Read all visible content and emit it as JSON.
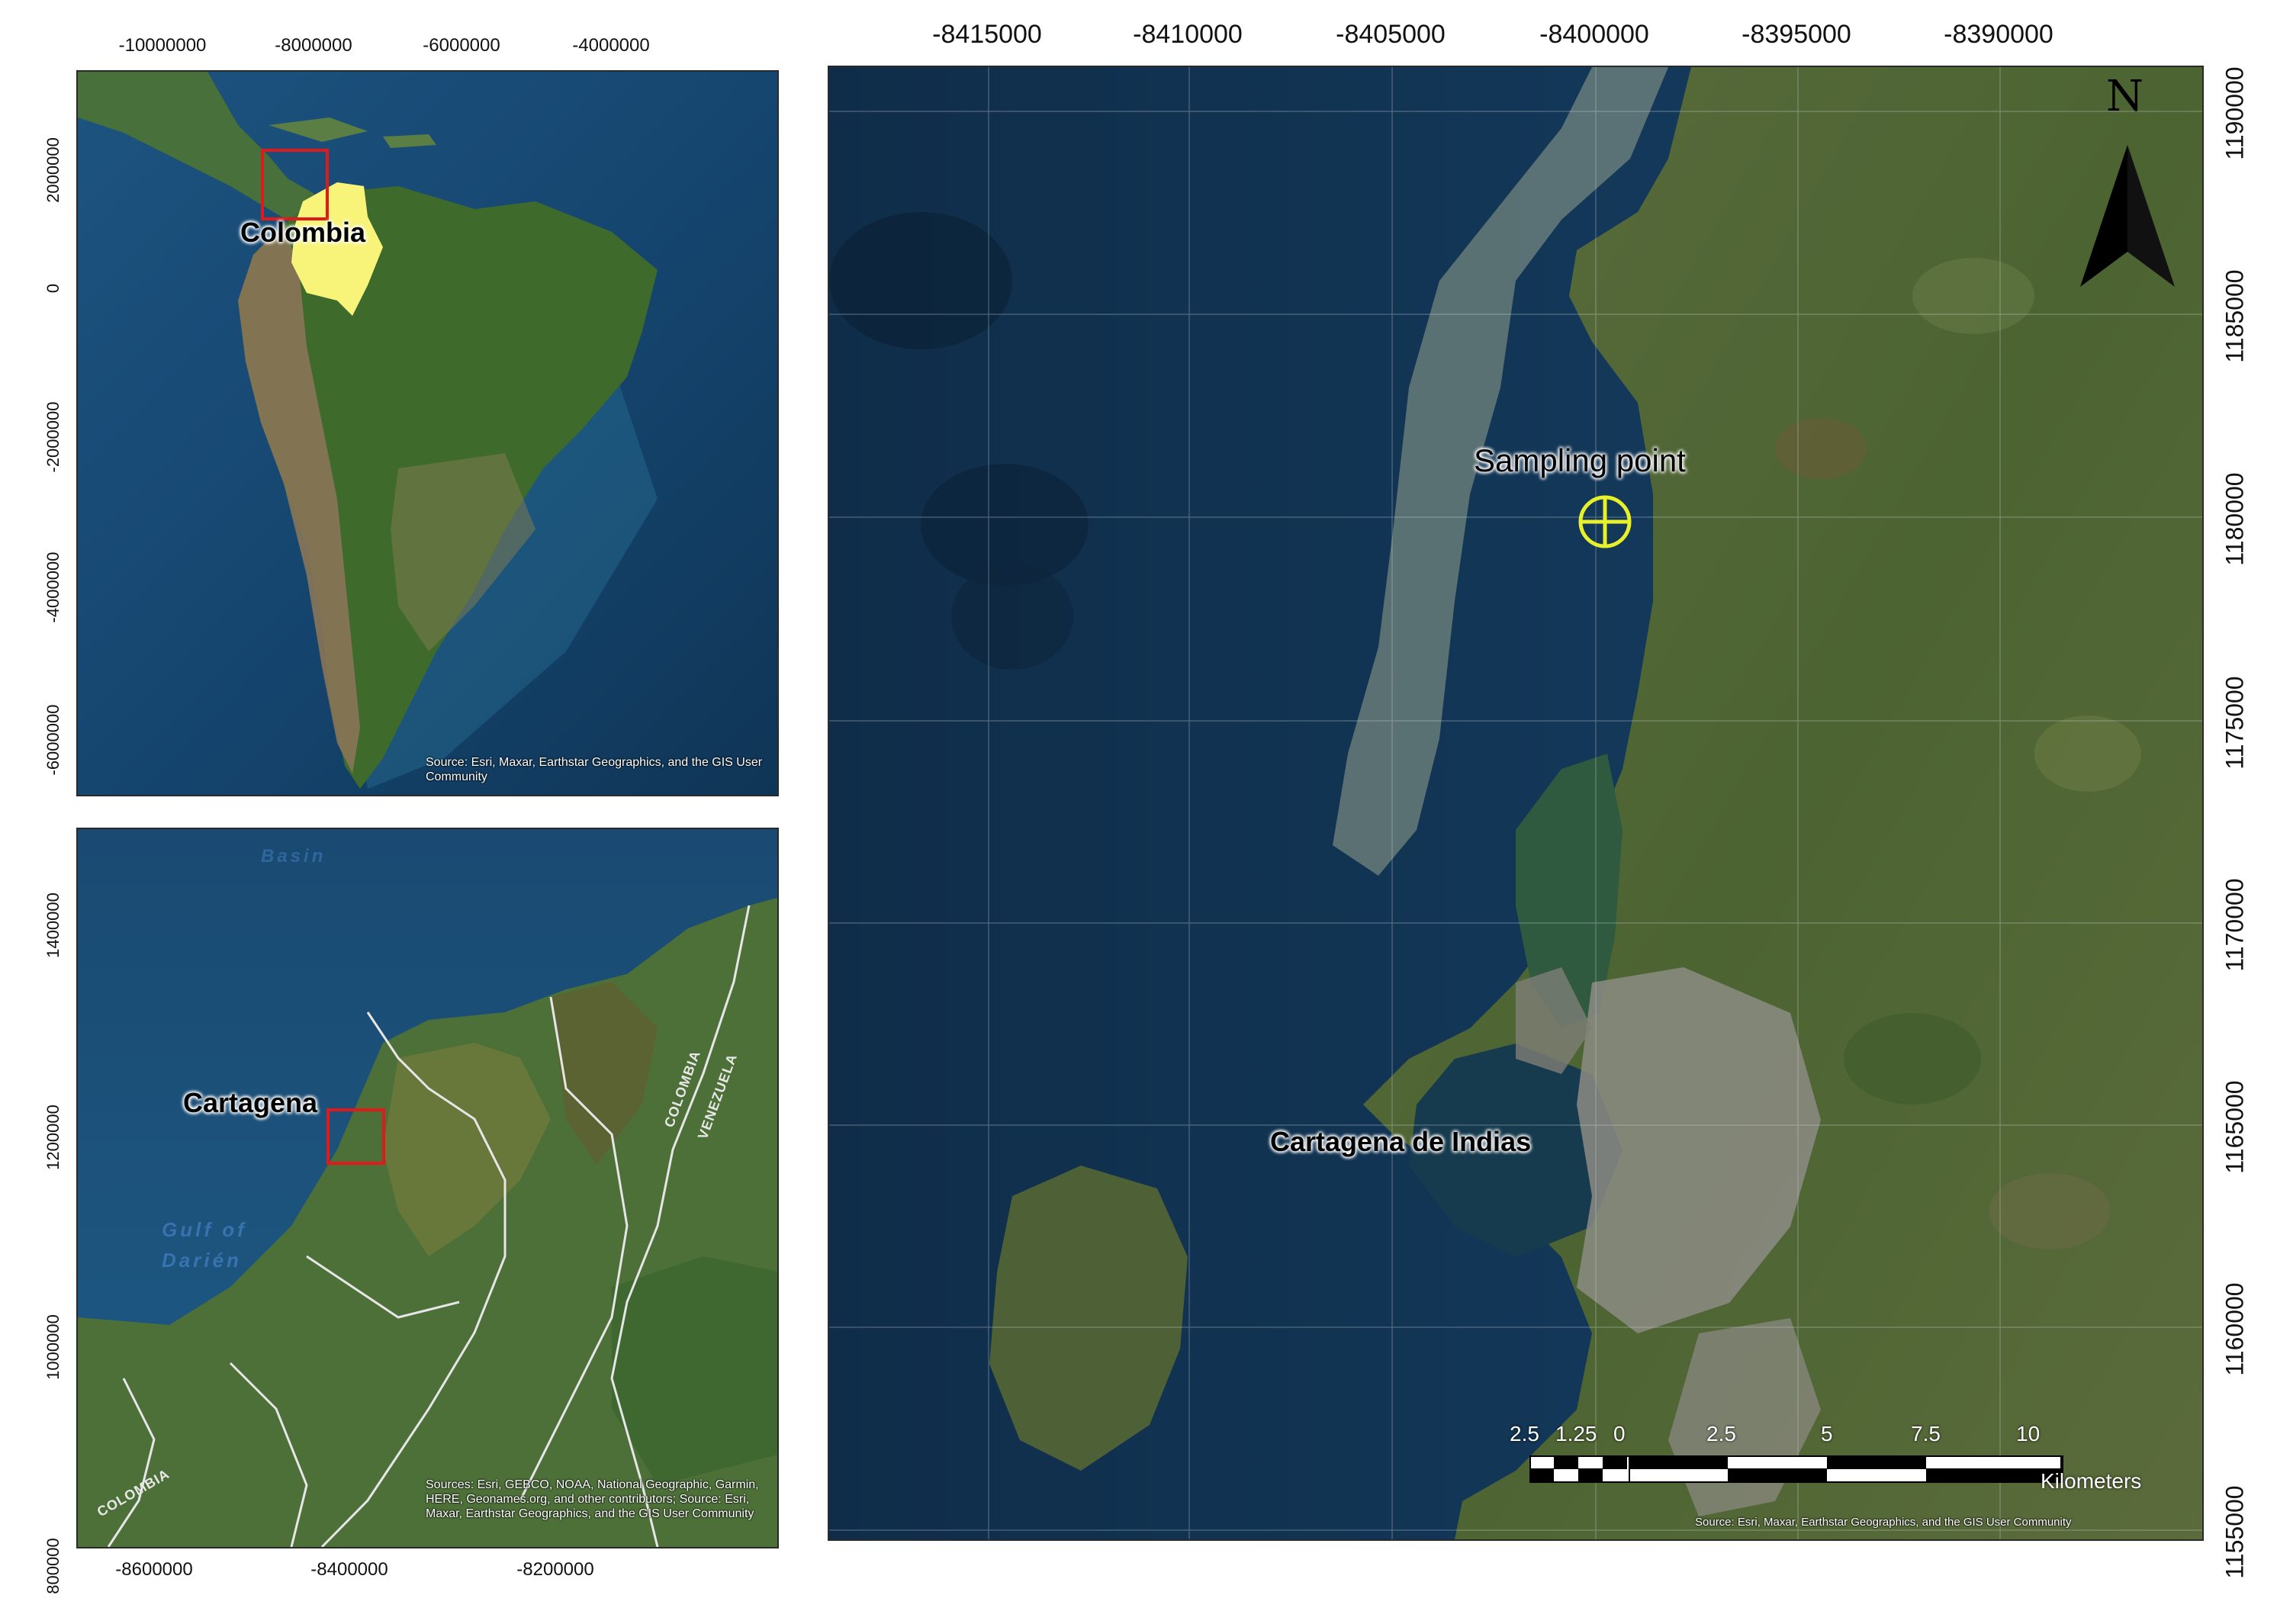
{
  "panels": {
    "south_america": {
      "x_ticks": [
        "-10000000",
        "-8000000",
        "-6000000",
        "-4000000"
      ],
      "y_ticks": [
        "2000000",
        "0",
        "-2000000",
        "-4000000",
        "-6000000"
      ],
      "label": "Colombia",
      "credit": "Source: Esri, Maxar, Earthstar Geographics, and the GIS User Community",
      "colors": {
        "country_fill": "#f8f47a",
        "locator_box": "#e01a1a"
      }
    },
    "region": {
      "x_ticks": [
        "-8600000",
        "-8400000",
        "-8200000"
      ],
      "y_ticks": [
        "1400000",
        "1200000",
        "1000000",
        "800000"
      ],
      "label": "Cartagena",
      "water_labels": [
        "Gulf of Darién",
        "Basin"
      ],
      "border_labels": [
        "COLOMBIA",
        "VENEZUELA",
        "COLOMBIA"
      ],
      "credit": "Sources: Esri, GEBCO, NOAA, National Geographic, Garmin, HERE, Geonames.org, and other contributors; Source: Esri, Maxar, Earthstar Geographics, and the GIS User Community",
      "colors": {
        "locator_box": "#e01a1a"
      }
    },
    "main": {
      "x_ticks": [
        "-8415000",
        "-8410000",
        "-8405000",
        "-8400000",
        "-8395000",
        "-8390000"
      ],
      "y_ticks": [
        "1190000",
        "1185000",
        "1180000",
        "1175000",
        "1170000",
        "1165000",
        "1160000",
        "1155000"
      ],
      "sampling_label": "Sampling point",
      "city_label": "Cartagena de Indias",
      "north_letter": "N",
      "scale_bar": {
        "labels": [
          "2.5",
          "1.25",
          "0",
          "2.5",
          "5",
          "7.5",
          "10"
        ],
        "unit": "Kilometers"
      },
      "credit": "Source: Esri, Maxar, Earthstar Geographics, and the GIS User Community",
      "colors": {
        "sampling_marker": "#e8f02a",
        "north_arrow": "#000000"
      }
    }
  }
}
